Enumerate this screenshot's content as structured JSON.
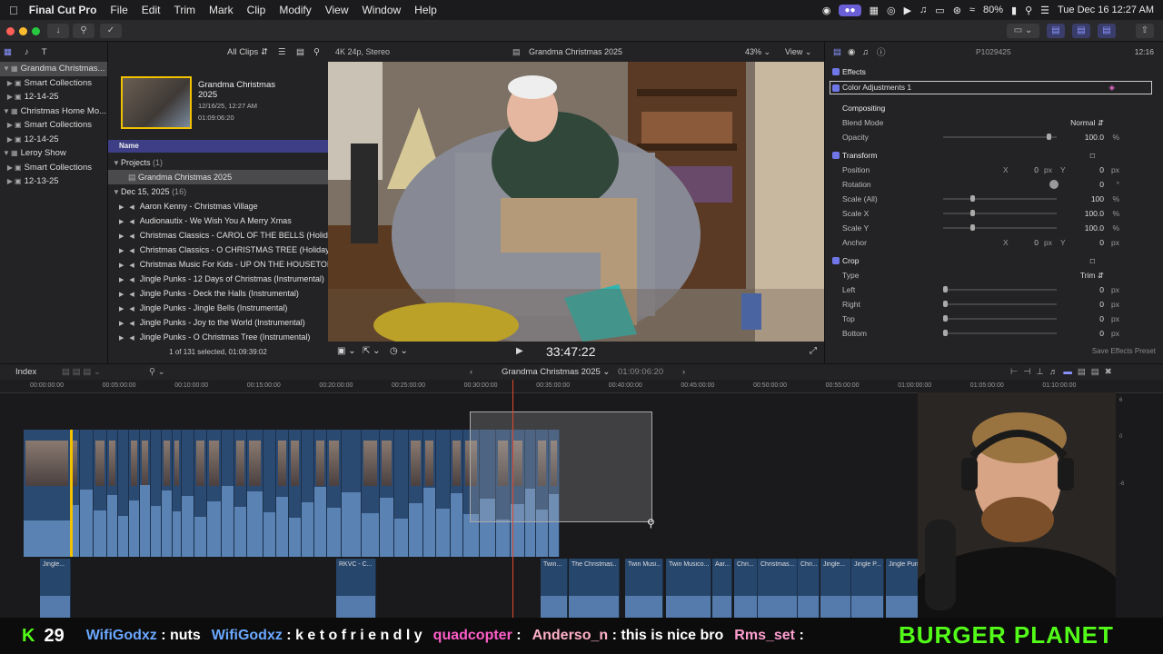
{
  "menubar": {
    "app": "Final Cut Pro",
    "items": [
      "File",
      "Edit",
      "Trim",
      "Mark",
      "Clip",
      "Modify",
      "View",
      "Window",
      "Help"
    ],
    "battery": "80%",
    "datetime": "Tue Dec 16  12:27 AM"
  },
  "libraries": [
    {
      "label": "Grandma Christmas...",
      "level": 0,
      "selected": true,
      "expanded": true
    },
    {
      "label": "Smart Collections",
      "level": 1
    },
    {
      "label": "12-14-25",
      "level": 1
    },
    {
      "label": "Christmas Home Mo...",
      "level": 0,
      "expanded": true
    },
    {
      "label": "Smart Collections",
      "level": 1
    },
    {
      "label": "12-14-25",
      "level": 1
    },
    {
      "label": "Leroy Show",
      "level": 0,
      "expanded": true
    },
    {
      "label": "Smart Collections",
      "level": 1
    },
    {
      "label": "12-13-25",
      "level": 1
    }
  ],
  "browser": {
    "filter": "All Clips",
    "project_title": "Grandma Christmas 2025",
    "project_date": "12/16/25, 12:27 AM",
    "project_duration": "01:09:06:20",
    "column_name": "Name",
    "projects_header": "Projects",
    "projects_count": "(1)",
    "project_item": "Grandma Christmas 2025",
    "event_header": "Dec 15, 2025",
    "event_count": "(16)",
    "items": [
      "Aaron Kenny - Christmas Village",
      "Audionautix - We Wish You A Merry Xmas",
      "Christmas Classics - CAROL OF THE BELLS (Holida",
      "Christmas Classics - O CHRISTMAS TREE (Holiday",
      "Christmas Music For Kids - UP ON THE HOUSETOI",
      "Jingle Punks - 12 Days of Christmas (Instrumental)",
      "Jingle Punks - Deck the Halls (Instrumental)",
      "Jingle Punks - Jingle Bells (Instrumental)",
      "Jingle Punks - Joy to the World (Instrumental)",
      "Jingle Punks - O Christmas Tree (Instrumental)"
    ],
    "status": "1 of 131 selected, 01:09:39:02"
  },
  "viewer": {
    "format": "4K 24p, Stereo",
    "title": "Grandma Christmas 2025",
    "zoom": "43%",
    "view": "View",
    "timecode": "33:47:22"
  },
  "inspector": {
    "clip_id": "P1029425",
    "duration": "12:16",
    "effects": "Effects",
    "color_adj": "Color Adjustments 1",
    "compositing": "Compositing",
    "blend_mode": {
      "label": "Blend Mode",
      "value": "Normal"
    },
    "opacity": {
      "label": "Opacity",
      "value": "100.0",
      "unit": "%",
      "level": 0.95
    },
    "transform": "Transform",
    "position": {
      "label": "Position",
      "x": "0",
      "y": "0",
      "unit": "px"
    },
    "rotation": {
      "label": "Rotation",
      "value": "0",
      "unit": "°"
    },
    "scale_all": {
      "label": "Scale (All)",
      "value": "100",
      "unit": "%",
      "level": 0.25
    },
    "scale_x": {
      "label": "Scale X",
      "value": "100.0",
      "unit": "%",
      "level": 0.25
    },
    "scale_y": {
      "label": "Scale Y",
      "value": "100.0",
      "unit": "%",
      "level": 0.25
    },
    "anchor": {
      "label": "Anchor",
      "x": "0",
      "y": "0",
      "unit": "px"
    },
    "crop": "Crop",
    "crop_type": {
      "label": "Type",
      "value": "Trim"
    },
    "crop_left": {
      "label": "Left",
      "value": "0",
      "unit": "px"
    },
    "crop_right": {
      "label": "Right",
      "value": "0",
      "unit": "px"
    },
    "crop_top": {
      "label": "Top",
      "value": "0",
      "unit": "px"
    },
    "crop_bottom": {
      "label": "Bottom",
      "value": "0",
      "unit": "px"
    },
    "save_preset": "Save Effects Preset",
    "x_label": "X",
    "y_label": "Y"
  },
  "timeline": {
    "index": "Index",
    "project": "Grandma Christmas 2025",
    "duration": "01:09:06:20",
    "ruler": [
      "00:00:00:00",
      "00:05:00:00",
      "00:10:00:00",
      "00:15:00:00",
      "00:20:00:00",
      "00:25:00:00",
      "00:30:00:00",
      "00:35:00:00",
      "00:40:00:00",
      "00:45:00:00",
      "00:50:00:00",
      "00:55:00:00",
      "01:00:00:00",
      "01:05:00:00",
      "01:10:00:00"
    ],
    "audio_clips": [
      "Jingle...",
      "RKVC - C...",
      "Twin...",
      "The Christmas...",
      "Twin Musi...",
      "Twin Musico...",
      "Aar...",
      "Chri...",
      "Christmas...",
      "Chri...",
      "Jingle...",
      "Jingle P...",
      "Jingle Pun"
    ],
    "meter_labels": [
      "6",
      "0",
      "-6"
    ]
  },
  "chat": {
    "count": "29",
    "messages": [
      {
        "user": "WifiGodxz",
        "sep": " : ",
        "text": "nuts",
        "color": "#6aa8ff"
      },
      {
        "user": "WifiGodxz",
        "sep": " : ",
        "text": "k e t o f r i e n d l y",
        "color": "#6aa8ff"
      },
      {
        "user": "quadcopter",
        "sep": " : ",
        "text": "",
        "color": "#ff5ec9"
      },
      {
        "user": "Anderso_n",
        "sep": " : ",
        "text": "this is nice bro",
        "color": "#ffb0c8"
      },
      {
        "user": "Rms_set",
        "sep": " : ",
        "text": "",
        "color": "#ff9fd0"
      }
    ],
    "banner": "BURGER PLANET"
  }
}
